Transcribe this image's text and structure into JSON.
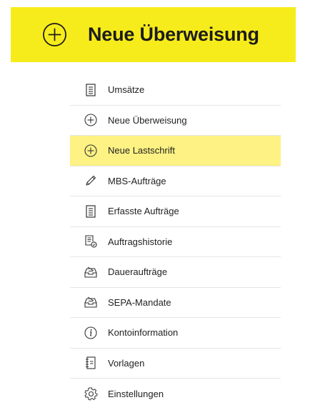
{
  "header": {
    "title": "Neue Überweisung",
    "icon": "plus-circle-icon",
    "background_color": "#f7ec1b"
  },
  "menu": {
    "active_color": "#fdf283",
    "items": [
      {
        "label": "Umsätze",
        "icon": "document-list-icon",
        "active": false
      },
      {
        "label": "Neue Überweisung",
        "icon": "plus-circle-icon",
        "active": false
      },
      {
        "label": "Neue Lastschrift",
        "icon": "plus-circle-icon",
        "active": true
      },
      {
        "label": "MBS-Aufträge",
        "icon": "pencil-icon",
        "active": false
      },
      {
        "label": "Erfasste Aufträge",
        "icon": "document-list-icon",
        "active": false
      },
      {
        "label": "Auftragshistorie",
        "icon": "document-check-icon",
        "active": false
      },
      {
        "label": "Daueraufträge",
        "icon": "inbox-tray-icon",
        "active": false
      },
      {
        "label": "SEPA-Mandate",
        "icon": "inbox-tray-icon",
        "active": false
      },
      {
        "label": "Kontoinformation",
        "icon": "info-circle-icon",
        "active": false
      },
      {
        "label": "Vorlagen",
        "icon": "notebook-icon",
        "active": false
      },
      {
        "label": "Einstellungen",
        "icon": "gear-icon",
        "active": false
      }
    ]
  }
}
